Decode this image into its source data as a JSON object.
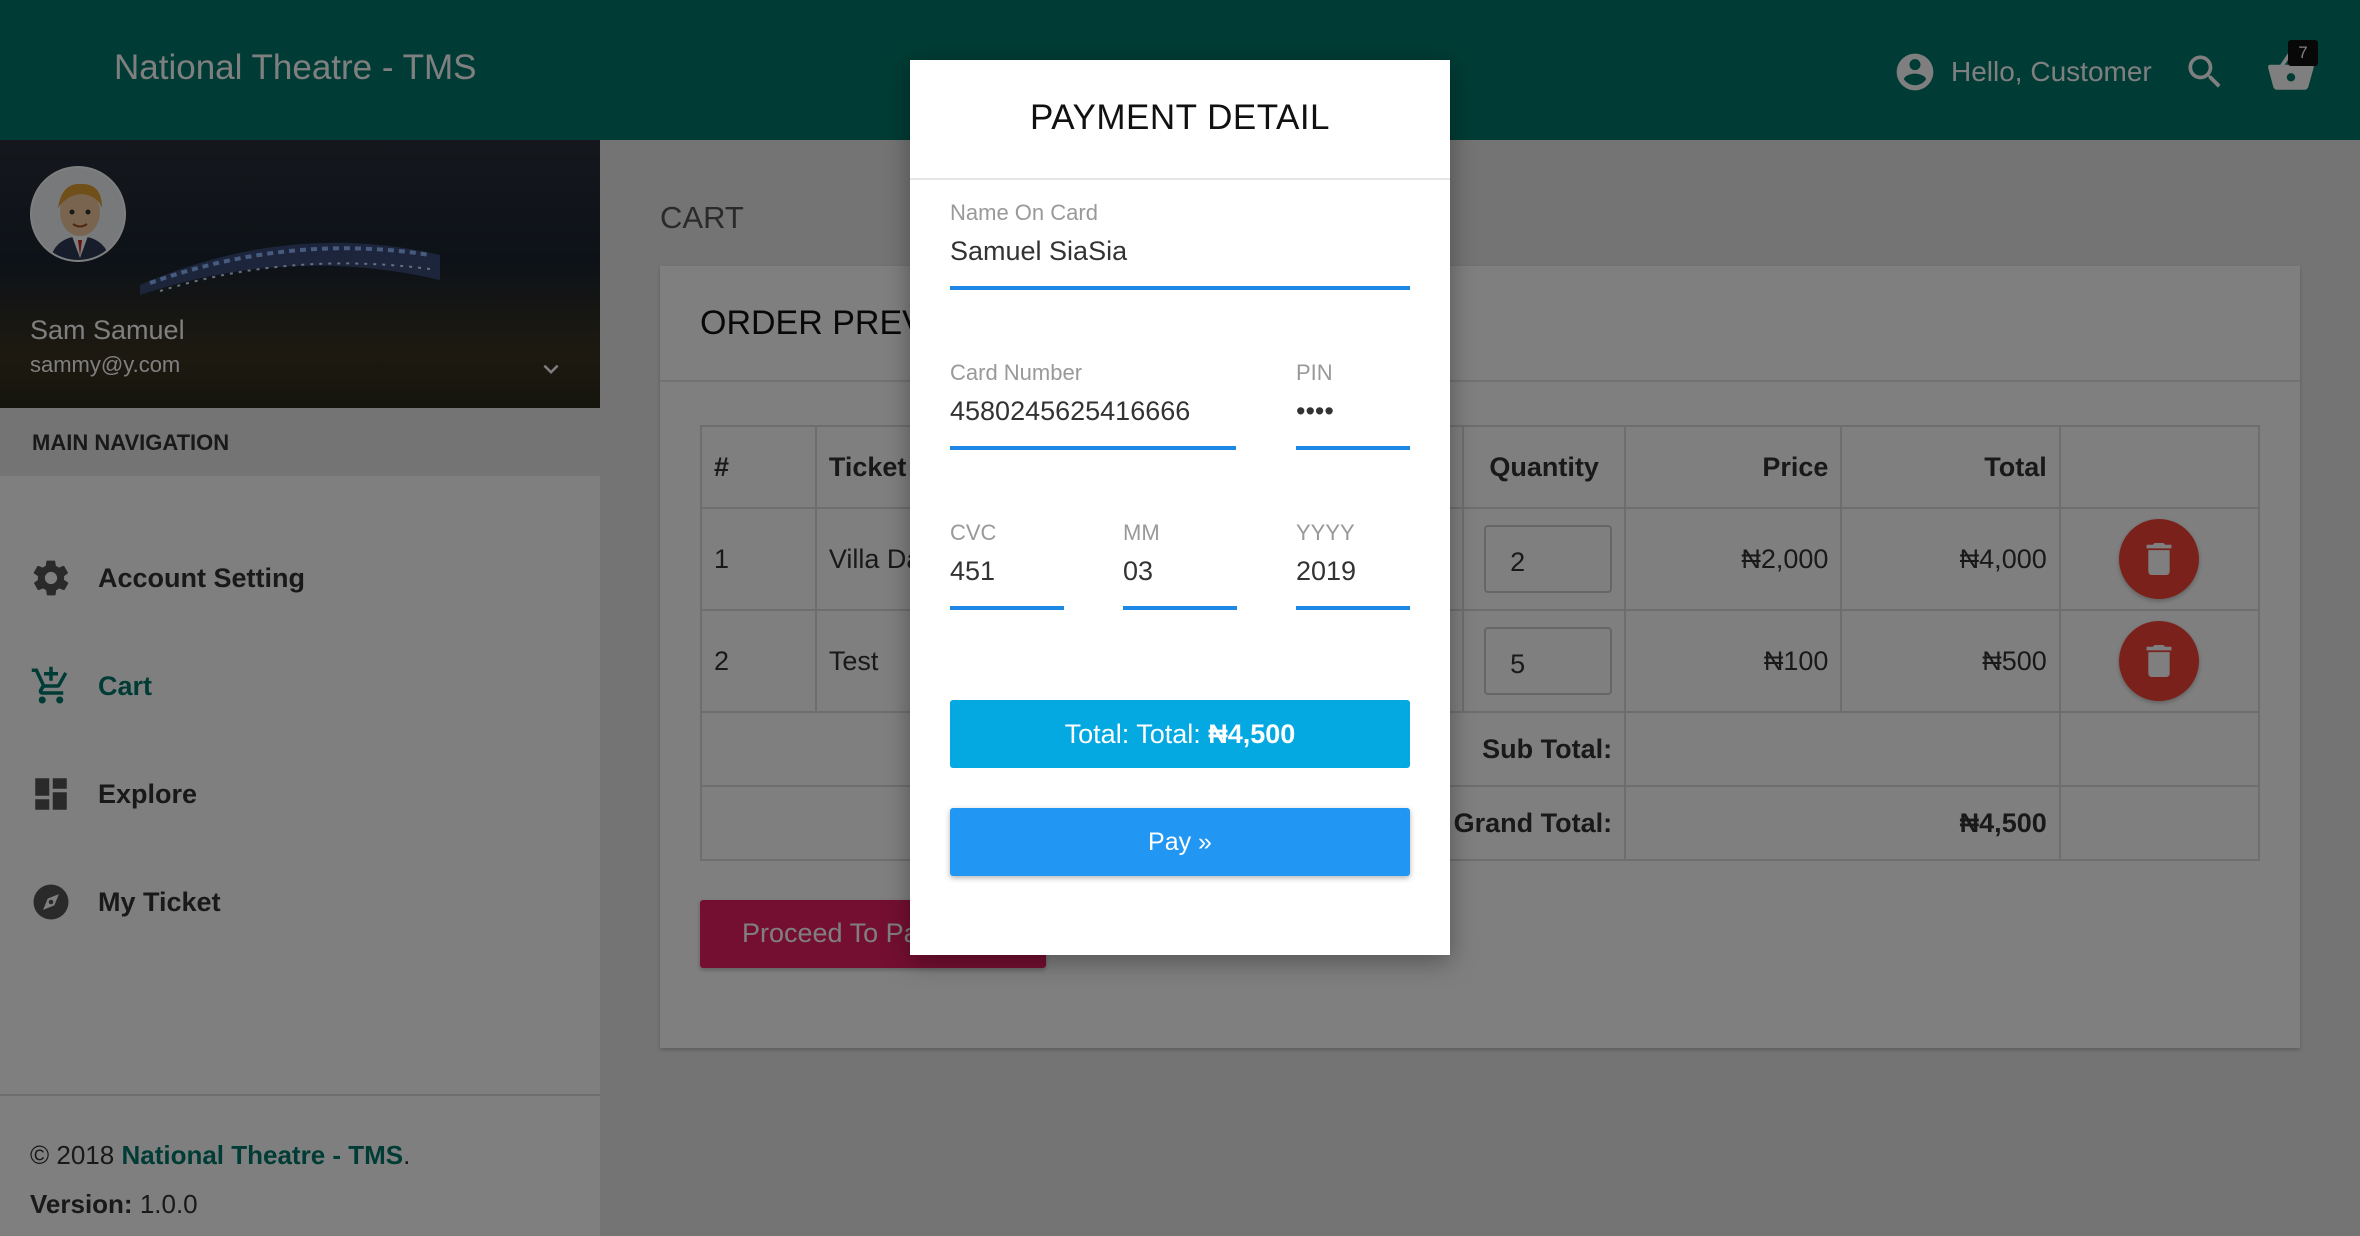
{
  "header": {
    "brand": "National Theatre - TMS",
    "greeting": "Hello, Customer",
    "cart_count": "7"
  },
  "sidebar": {
    "profile": {
      "name": "Sam Samuel",
      "email": "sammy@y.com"
    },
    "nav_header": "MAIN NAVIGATION",
    "items": [
      {
        "label": "Account Setting",
        "icon": "gear-icon"
      },
      {
        "label": "Cart",
        "icon": "add-cart-icon",
        "active": true
      },
      {
        "label": "Explore",
        "icon": "dashboard-icon"
      },
      {
        "label": "My Ticket",
        "icon": "compass-icon"
      }
    ],
    "footer": {
      "copyright": "© 2018 ",
      "brand": "National Theatre - TMS",
      "period": ".",
      "version_label": "Version:",
      "version": " 1.0.0"
    }
  },
  "main": {
    "page_title": "CART",
    "card_title": "ORDER PREVIEW",
    "table": {
      "headers": [
        "#",
        "Ticket",
        "Quantity",
        "Price",
        "Total"
      ],
      "rows": [
        {
          "num": "1",
          "ticket": "Villa Da",
          "qty": "2",
          "price": "₦2,000",
          "total": "₦4,000"
        },
        {
          "num": "2",
          "ticket": "Test",
          "qty": "5",
          "price": "₦100",
          "total": "₦500"
        }
      ],
      "subtotal_label": "Sub Total:",
      "grand_total_label": "Grand Total:",
      "grand_total": "₦4,500"
    },
    "proceed_button": "Proceed To Payment"
  },
  "modal": {
    "title": "PAYMENT DETAIL",
    "fields": {
      "name_on_card": {
        "label": "Name On Card",
        "value": "Samuel SiaSia"
      },
      "card_number": {
        "label": "Card Number",
        "value": "4580245625416666"
      },
      "pin": {
        "label": "PIN",
        "value": "••••"
      },
      "cvc": {
        "label": "CVC",
        "value": "451"
      },
      "mm": {
        "label": "MM",
        "value": "03"
      },
      "yyyy": {
        "label": "YYYY",
        "value": "2019"
      }
    },
    "total_prefix": "Total: Total: ",
    "total_amount": "₦4,500",
    "pay_button": "Pay »"
  },
  "colors": {
    "primary": "#00796b",
    "delete": "#f44336",
    "proceed": "#e91e63",
    "total_box": "#03a9e0",
    "pay": "#2196f3",
    "field_underline": "#1e88e5"
  }
}
